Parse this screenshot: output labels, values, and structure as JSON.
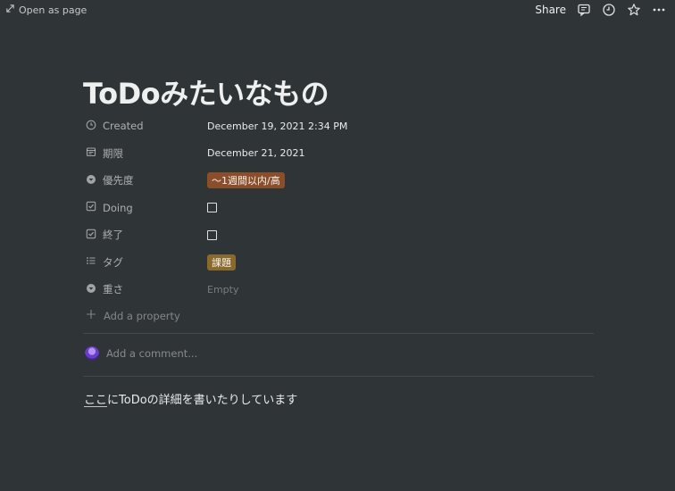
{
  "topbar": {
    "open_as_page": "Open as page",
    "share": "Share",
    "icons": [
      "comment-icon",
      "clock-icon",
      "star-icon",
      "more-icon"
    ]
  },
  "page": {
    "title": "ToDoみたいなもの"
  },
  "properties": [
    {
      "icon": "clock-icon",
      "name": "Created",
      "type": "date",
      "value": "December 19, 2021 2:34 PM"
    },
    {
      "icon": "calendar-icon",
      "name": "期限",
      "type": "date",
      "value": "December 21, 2021"
    },
    {
      "icon": "select-icon",
      "name": "優先度",
      "type": "select",
      "value": "〜1週間以内/高",
      "color": "#8a4f2a"
    },
    {
      "icon": "checkbox-icon",
      "name": "Doing",
      "type": "checkbox",
      "checked": false
    },
    {
      "icon": "checkbox-icon",
      "name": "終了",
      "type": "checkbox",
      "checked": false
    },
    {
      "icon": "list-icon",
      "name": "タグ",
      "type": "multi_select",
      "value": "課題",
      "color": "#8a6a2c"
    },
    {
      "icon": "select-icon",
      "name": "重さ",
      "type": "select",
      "value": "Empty"
    }
  ],
  "add_property": "Add a property",
  "comment_placeholder": "Add a comment...",
  "body": {
    "underlined": "ここ",
    "rest": "にToDoの詳細を書いたりしています"
  }
}
